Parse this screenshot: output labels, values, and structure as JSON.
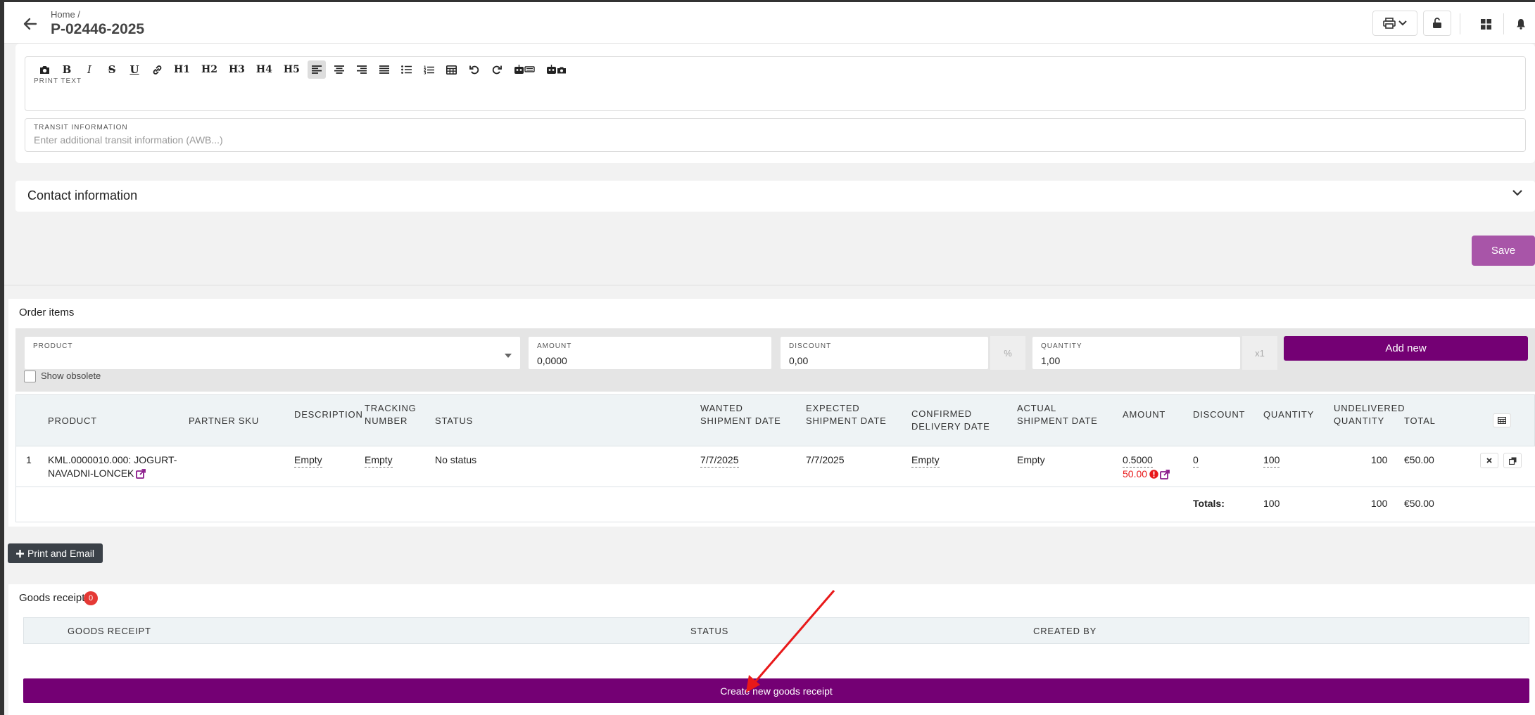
{
  "header": {
    "breadcrumb": "Home  /",
    "title": "P-02446-2025",
    "icons": [
      "back-arrow-icon",
      "printer-icon",
      "unlock-icon",
      "grid-icon",
      "bell-icon"
    ]
  },
  "editor": {
    "toolbar": [
      "camera",
      "bold",
      "italic",
      "strikethrough",
      "underline",
      "link",
      "H1",
      "H2",
      "H3",
      "H4",
      "H5",
      "align-left",
      "align-center",
      "align-right",
      "justify",
      "bullet-list",
      "numbered-list",
      "table",
      "undo",
      "redo",
      "robot-keyboard",
      "robot-camera"
    ],
    "headings": [
      "H1",
      "H2",
      "H3",
      "H4",
      "H5"
    ],
    "print_label": "PRINT TEXT"
  },
  "transit": {
    "label": "TRANSIT INFORMATION",
    "placeholder": "Enter additional transit information (AWB...)"
  },
  "contact": {
    "title": "Contact information"
  },
  "save_label": "Save",
  "order_items": {
    "title": "Order items",
    "product_label": "PRODUCT",
    "amount_label": "AMOUNT",
    "amount_value": "0,0000",
    "discount_label": "DISCOUNT",
    "discount_value": "0,00",
    "discount_suffix": "%",
    "quantity_label": "QUANTITY",
    "quantity_value": "1,00",
    "quantity_suffix": "x1",
    "show_obsolete": "Show obsolete",
    "add_new": "Add new",
    "columns": {
      "product": "PRODUCT",
      "partner_sku": "PARTNER SKU",
      "description": "DESCRIPTION",
      "tracking_1": "TRACKING",
      "tracking_2": "NUMBER",
      "status": "STATUS",
      "wanted_1": "WANTED",
      "wanted_2": "SHIPMENT DATE",
      "expected_1": "EXPECTED",
      "expected_2": "SHIPMENT DATE",
      "confirmed_1": "CONFIRMED",
      "confirmed_2": "DELIVERY DATE",
      "actual_1": "ACTUAL",
      "actual_2": "SHIPMENT DATE",
      "amount": "AMOUNT",
      "discount": "DISCOUNT",
      "quantity": "QUANTITY",
      "undelivered_1": "UNDELIVERED",
      "undelivered_2": "QUANTITY",
      "total": "TOTAL"
    },
    "rows": [
      {
        "index": "1",
        "product_1": "KML.0000010.000: JOGURT-",
        "product_2": "NAVADNI-LONCEK",
        "description": "Empty",
        "tracking": "Empty",
        "status": "No status",
        "wanted": "7/7/2025",
        "expected": "7/7/2025",
        "confirmed": "Empty",
        "actual": "Empty",
        "amount": "0.5000",
        "amount_alt": "50.00",
        "discount": "0",
        "quantity": "100",
        "undelivered": "100",
        "total": "€50.00"
      }
    ],
    "totals": {
      "label": "Totals:",
      "quantity": "100",
      "undelivered": "100",
      "total": "€50.00"
    }
  },
  "print_email": "Print and Email",
  "goods_receipt": {
    "title": "Goods receipt",
    "count": "0",
    "columns": {
      "goods_receipt": "GOODS RECEIPT",
      "status": "STATUS",
      "created_by": "CREATED BY"
    },
    "create_label": "Create new goods receipt"
  },
  "colors": {
    "primary": "#740074",
    "save": "#a855a8",
    "badge": "#e53935",
    "arrow": "#e8191a"
  }
}
